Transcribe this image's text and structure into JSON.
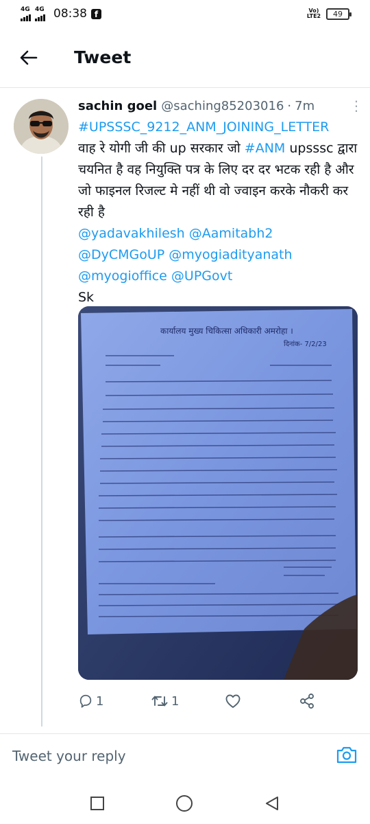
{
  "status_bar": {
    "network1": "4G",
    "network2": "4G",
    "time": "08:38",
    "volte": "Vo) LTE2",
    "battery": "49"
  },
  "header": {
    "title": "Tweet"
  },
  "tweet": {
    "author_name": "sachin goel",
    "author_handle": "@saching85203016",
    "separator": "·",
    "time": "7m",
    "hashtag_line": "#UPSSSC_9212_ANM_JOINING_LETTER",
    "text_part1": "वाह रे योगी जी की up सरकार जो ",
    "hashtag_anm": "#ANM",
    "text_part2": "upsssc द्वारा चयनित है वह नियुक्ति पत्र के लिए दर दर भटक रही है और जो फाइनल रिजल्ट मे नहीं थी वो ज्वाइन करके नौकरी कर रही है",
    "mentions": [
      "@yadavakhilesh",
      "@Aamitabh2",
      "@DyCMGoUP",
      "@myogiadityanath",
      "@myogioffice",
      "@UPGovt"
    ],
    "signoff": "Sk",
    "document": {
      "heading": "कार्यालय मुख्य चिकित्सा अधिकारी अमरोहा ।",
      "date": "दिनांक- 7/2/23"
    }
  },
  "actions": {
    "reply_count": "1",
    "retweet_count": "1",
    "like_count": ""
  },
  "reply": {
    "placeholder": "Tweet your reply"
  },
  "colors": {
    "link": "#1d9bf0",
    "secondary": "#536471",
    "text": "#0f1419"
  }
}
